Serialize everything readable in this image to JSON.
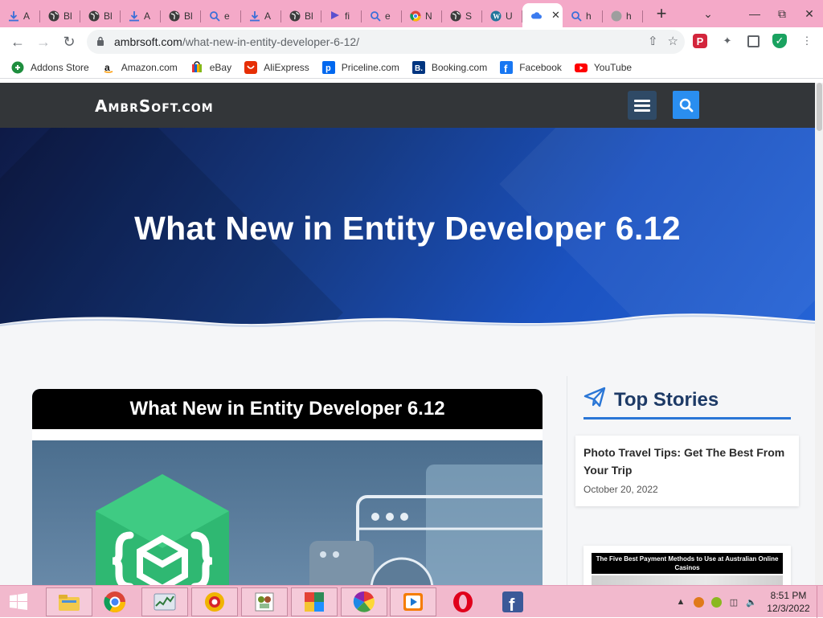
{
  "browser": {
    "tabs": [
      {
        "title": "A",
        "icon": "download-icon"
      },
      {
        "title": "Bl",
        "icon": "globe-icon"
      },
      {
        "title": "Bl",
        "icon": "globe-icon"
      },
      {
        "title": "A",
        "icon": "download-icon"
      },
      {
        "title": "Bl",
        "icon": "globe-icon"
      },
      {
        "title": "e",
        "icon": "search-icon"
      },
      {
        "title": "A",
        "icon": "download-icon"
      },
      {
        "title": "Bl",
        "icon": "globe-icon"
      },
      {
        "title": "fi",
        "icon": "flag-icon"
      },
      {
        "title": "e",
        "icon": "search-icon"
      },
      {
        "title": "N",
        "icon": "chrome-icon"
      },
      {
        "title": "S",
        "icon": "globe-icon"
      },
      {
        "title": "U",
        "icon": "wordpress-icon"
      },
      {
        "title": "",
        "icon": "cloud-icon",
        "active": true
      },
      {
        "title": "h",
        "icon": "search-icon"
      },
      {
        "title": "h",
        "icon": "globe-grey-icon"
      }
    ],
    "new_tab": "+",
    "url_host": "ambrsoft.com",
    "url_path": "/what-new-in-entity-developer-6-12/",
    "bookmarks": [
      {
        "label": "Addons Store",
        "icon": "addons-store-icon",
        "color": "#1e8e3e"
      },
      {
        "label": "Amazon.com",
        "icon": "amazon-icon",
        "color": "#ffffff"
      },
      {
        "label": "eBay",
        "icon": "ebay-icon",
        "color": "#ffffff"
      },
      {
        "label": "AliExpress",
        "icon": "aliexpress-icon",
        "color": "#e62e04"
      },
      {
        "label": "Priceline.com",
        "icon": "priceline-icon",
        "color": "#0068ef"
      },
      {
        "label": "Booking.com",
        "icon": "booking-icon",
        "color": "#003580"
      },
      {
        "label": "Facebook",
        "icon": "facebook-icon",
        "color": "#1877f2"
      },
      {
        "label": "YouTube",
        "icon": "youtube-icon",
        "color": "#ff0000"
      }
    ]
  },
  "site": {
    "logo": "AmbrSoft.com",
    "hero_title": "What New in Entity Developer 6.12",
    "featured_title": "What New in Entity Developer 6.12",
    "sidebar_title": "Top Stories",
    "stories": [
      {
        "title": "Photo Travel Tips: Get The Best From Your Trip",
        "date": "October 20, 2022"
      },
      {
        "title": "The Five Best Payment Methods to Use at Australian Online Casinos",
        "date": ""
      }
    ],
    "colors": {
      "header": "#333639",
      "accent": "#2a8ef0",
      "sidebar_title": "#1d3a66"
    }
  },
  "taskbar": {
    "apps": [
      "file-explorer-icon",
      "chrome-icon",
      "task-manager-icon",
      "browser-ball-icon",
      "solitaire-icon",
      "media-app-icon",
      "pinwheel-icon",
      "media-player-icon",
      "opera-icon",
      "facebook-icon"
    ],
    "time": "8:51 PM",
    "date": "12/3/2022"
  }
}
